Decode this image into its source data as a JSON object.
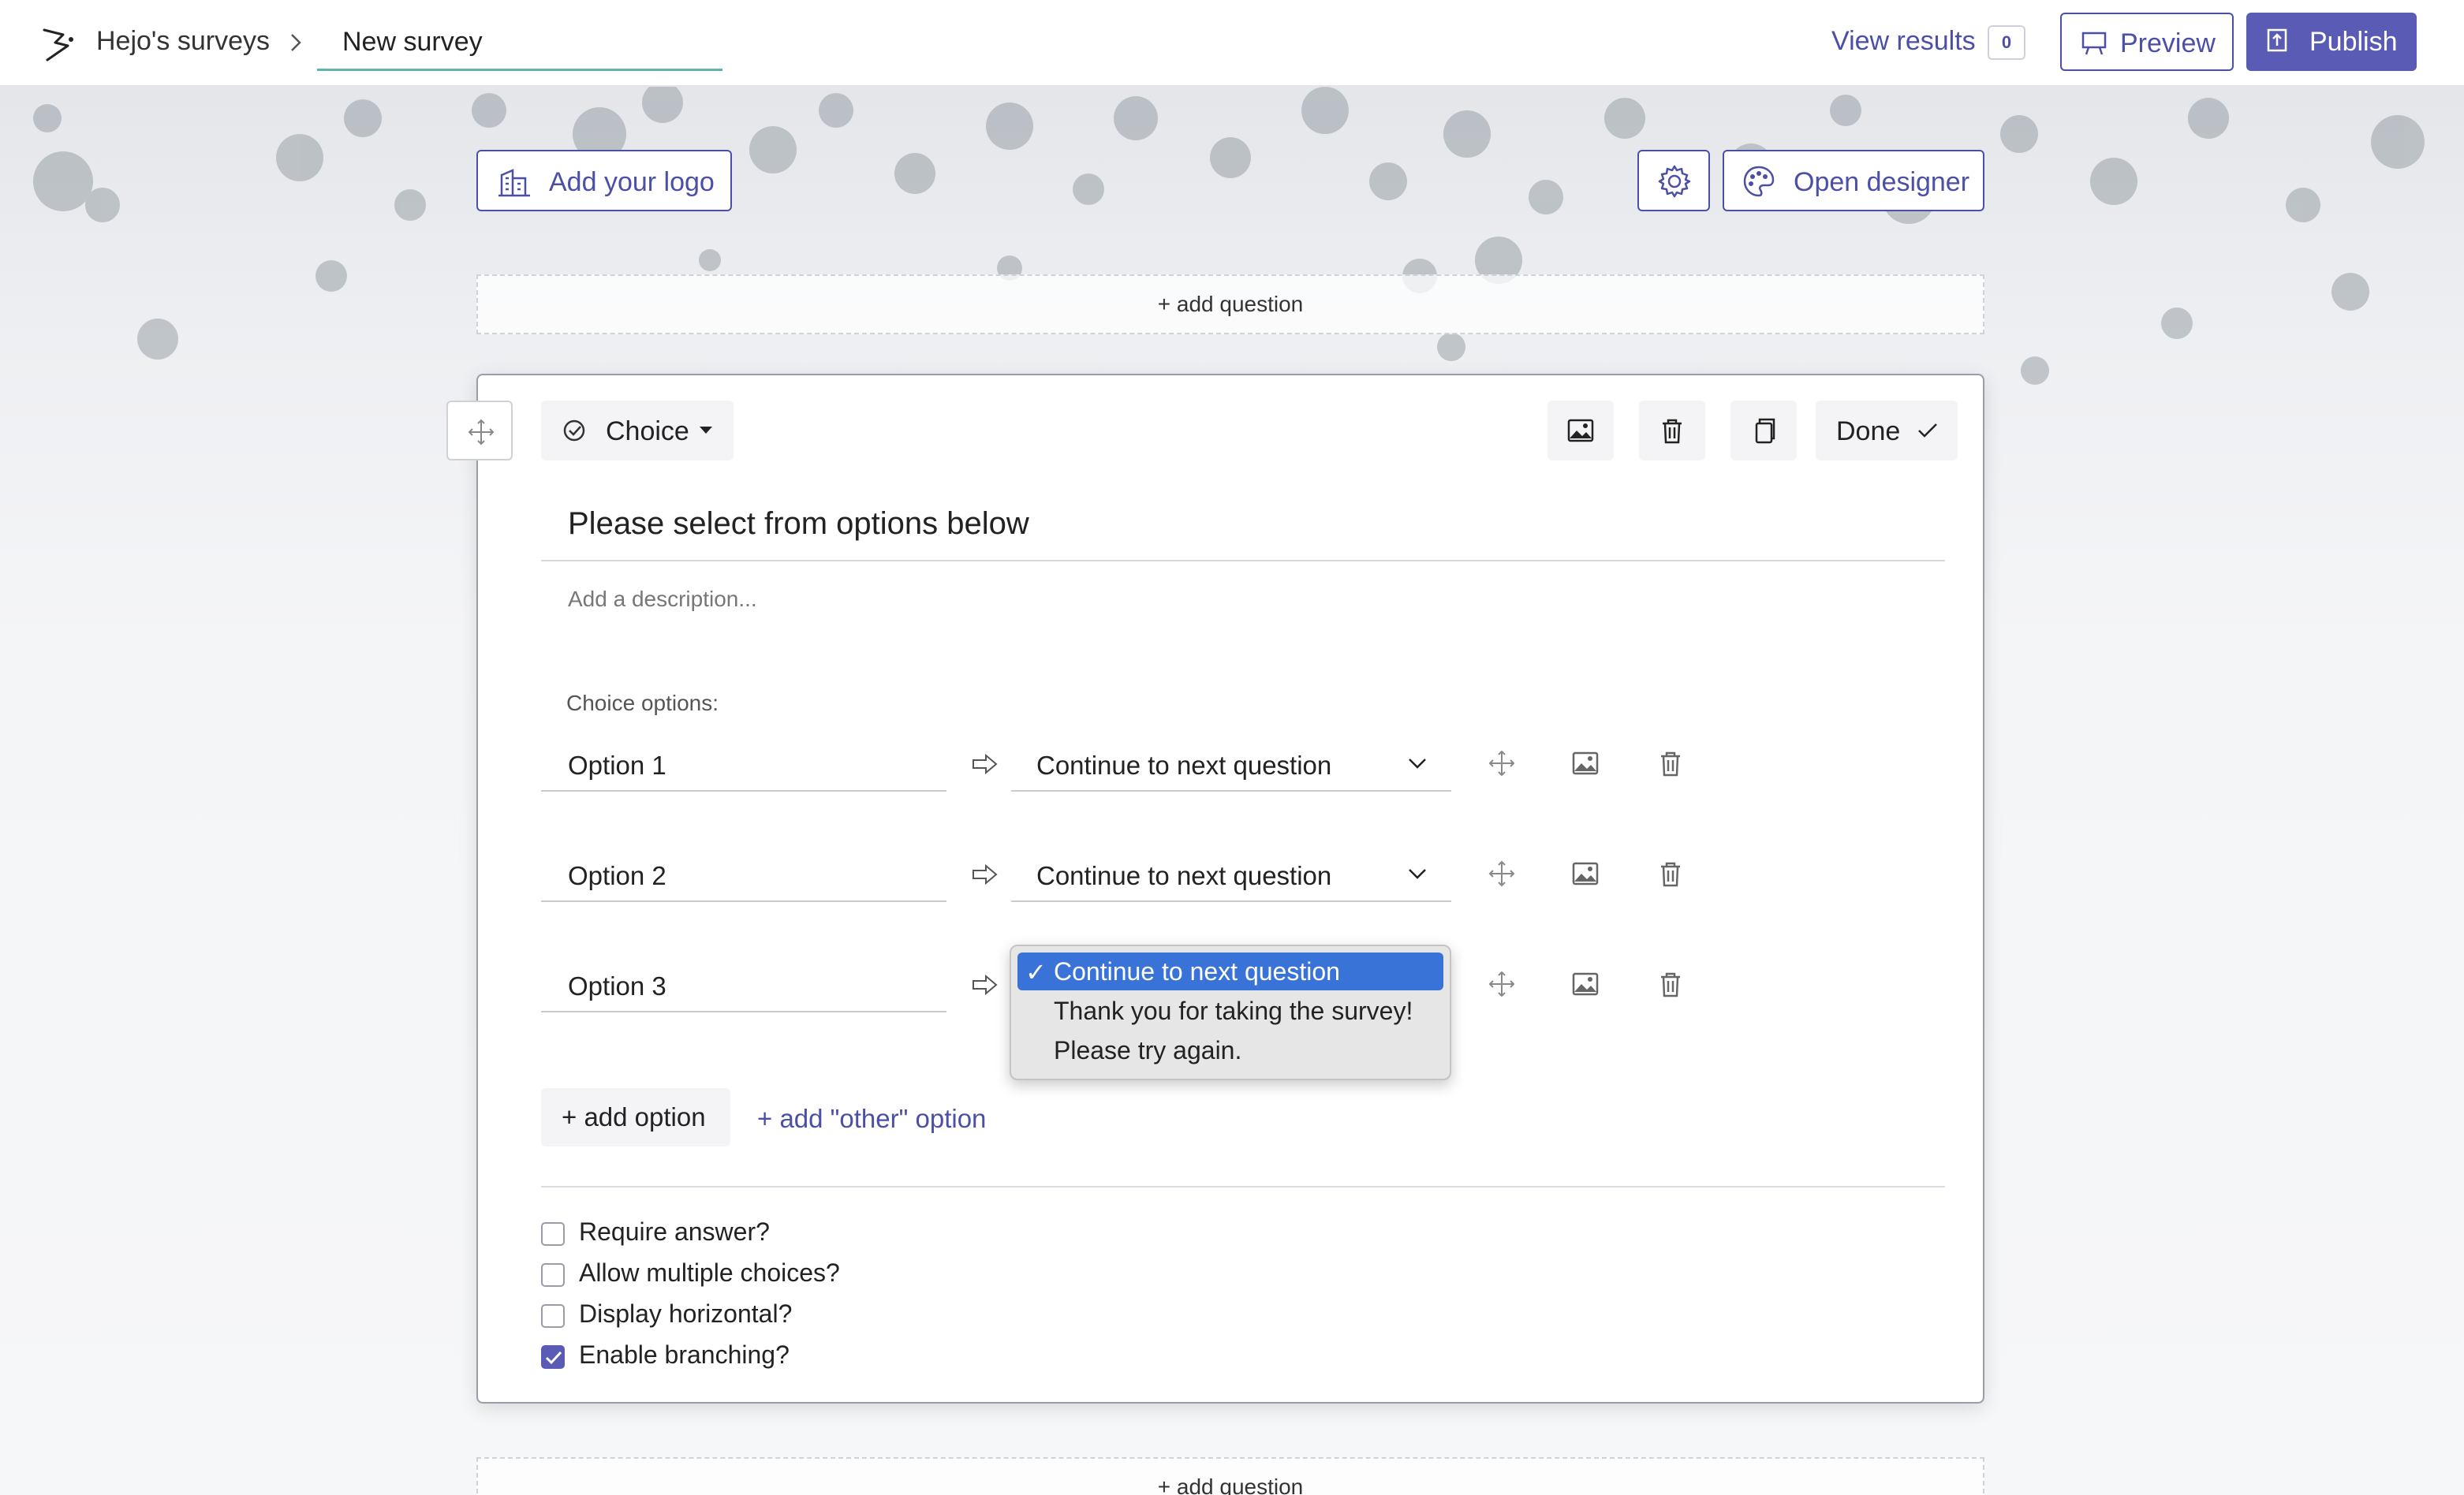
{
  "header": {
    "breadcrumb_root": "Hejo's surveys",
    "survey_title": "New survey",
    "view_results_label": "View results",
    "results_count": "0",
    "preview_label": "Preview",
    "publish_label": "Publish"
  },
  "toolbar": {
    "add_logo_label": "Add your logo",
    "open_designer_label": "Open designer",
    "add_question_label": "+ add question"
  },
  "question": {
    "type_label": "Choice",
    "done_label": "Done",
    "title": "Please select from options below",
    "description_placeholder": "Add a description...",
    "choice_options_label": "Choice options:",
    "options": [
      {
        "label": "Option 1",
        "branch": "Continue to next question"
      },
      {
        "label": "Option 2",
        "branch": "Continue to next question"
      },
      {
        "label": "Option 3",
        "branch": "Continue to next question"
      }
    ],
    "branch_dropdown": {
      "selected": "Continue to next question",
      "options": [
        "Continue to next question",
        "Thank you for taking the survey!",
        "Please try again."
      ]
    },
    "add_option_label": "+ add option",
    "add_other_label": "+ add \"other\" option",
    "settings": [
      {
        "label": "Require answer?",
        "checked": false
      },
      {
        "label": "Allow multiple choices?",
        "checked": false
      },
      {
        "label": "Display horizontal?",
        "checked": false
      },
      {
        "label": "Enable branching?",
        "checked": true
      }
    ]
  },
  "colors": {
    "accent": "#4b4fa6",
    "publish_bg": "#5a5bb5",
    "dropdown_selected": "#3a73d8",
    "title_underline": "#5fb5ad"
  },
  "icons": [
    "brand-logo-icon",
    "chevron-right-icon",
    "preview-icon",
    "publish-icon",
    "building-icon",
    "gear-icon",
    "palette-icon",
    "move-icon",
    "check-circle-icon",
    "caret-down-icon",
    "image-icon",
    "trash-icon",
    "copy-icon",
    "check-icon",
    "arrow-right-icon",
    "chevron-down-icon"
  ]
}
